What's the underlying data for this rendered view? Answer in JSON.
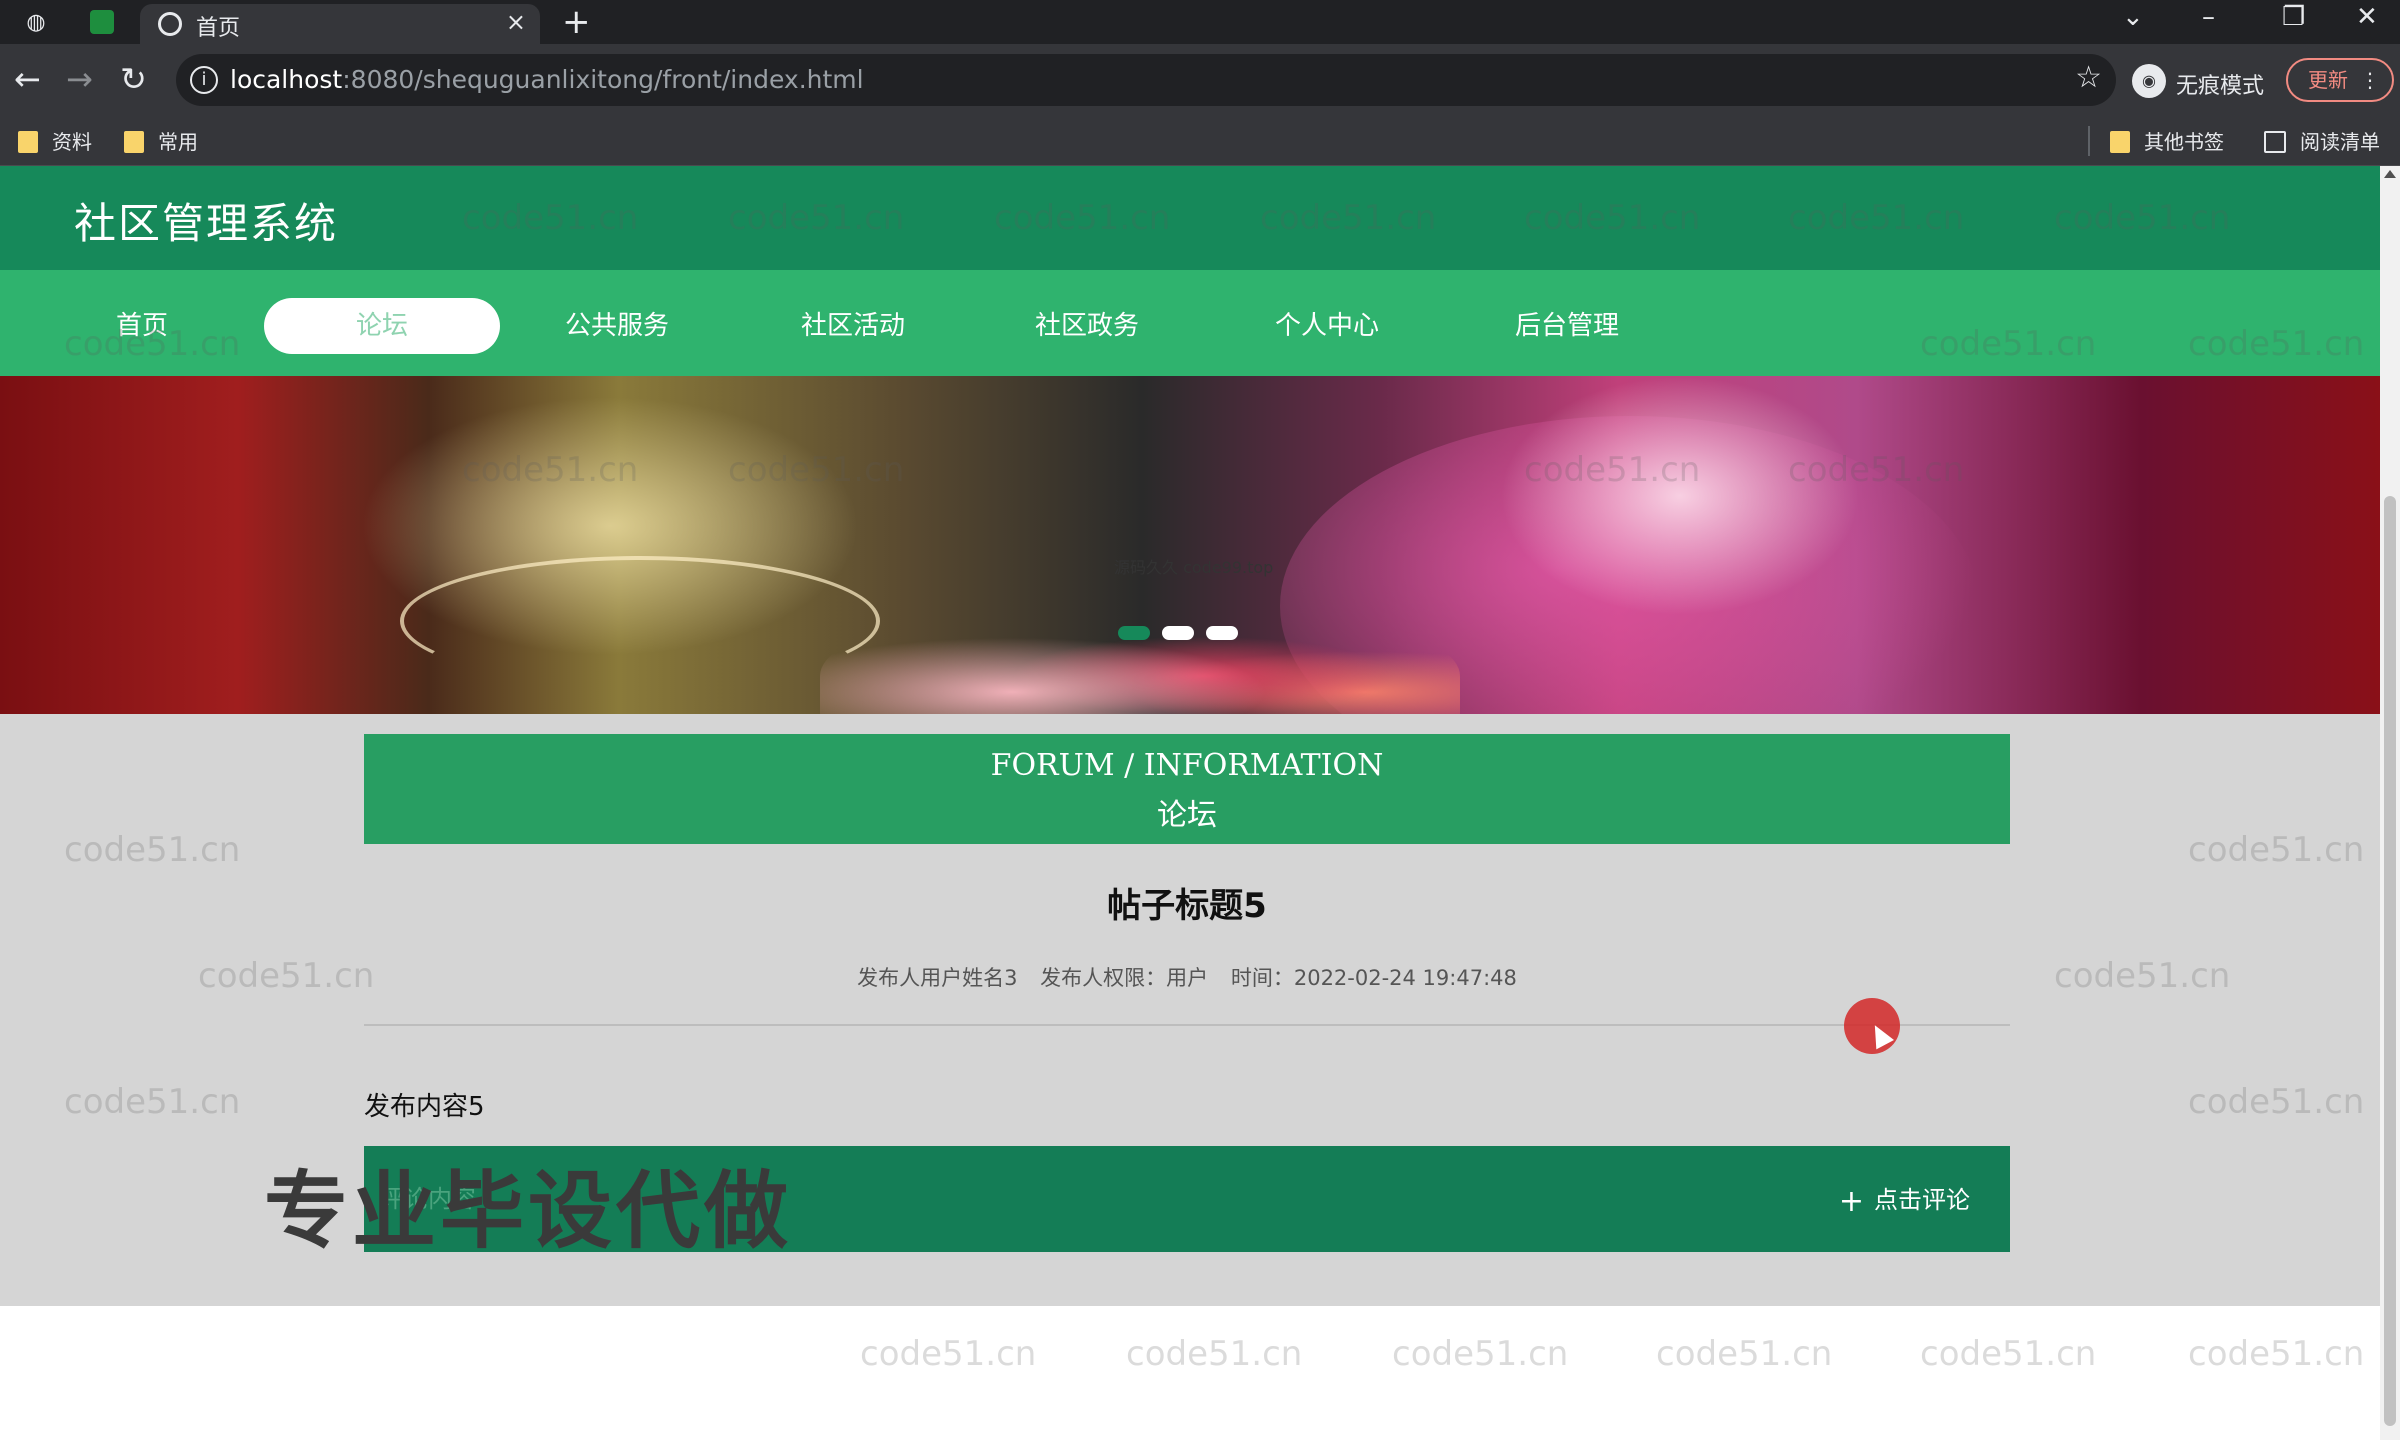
{
  "browser": {
    "tab_title": "首页",
    "tab_close": "×",
    "new_tab": "+",
    "url_host": "localhost",
    "url_rest": ":8080/shequguanlixitong/front/index.html",
    "incognito_label": "无痕模式",
    "update_label": "更新",
    "bookmarks": [
      "资料",
      "常用"
    ],
    "other_bookmarks": "其他书签",
    "reading_list": "阅读清单"
  },
  "site": {
    "title": "社区管理系统",
    "nav": [
      "首页",
      "论坛",
      "公共服务",
      "社区活动",
      "社区政务",
      "个人中心",
      "后台管理"
    ],
    "active_nav": "论坛"
  },
  "banner": {
    "slide_count": 3,
    "active_slide": 1
  },
  "forum": {
    "header_en": "FORUM / INFORMATION",
    "header_cn": "论坛"
  },
  "post": {
    "title": "帖子标题5",
    "publisher_name": "发布人用户姓名3",
    "publisher_role": "发布人权限：用户",
    "time": "时间：2022-02-24 19:47:48",
    "content": "发布内容5"
  },
  "comment": {
    "placeholder": "评论内容",
    "button_label": "点击评论"
  },
  "overlay": {
    "watermark_text": "code51.cn",
    "source_text": "源码久久 code99.top",
    "promo_text": "专业毕设代做"
  },
  "colors": {
    "header": "#16895a",
    "nav": "#2fb36e",
    "forum_header": "#289e62",
    "comment_bar": "#147d56"
  }
}
